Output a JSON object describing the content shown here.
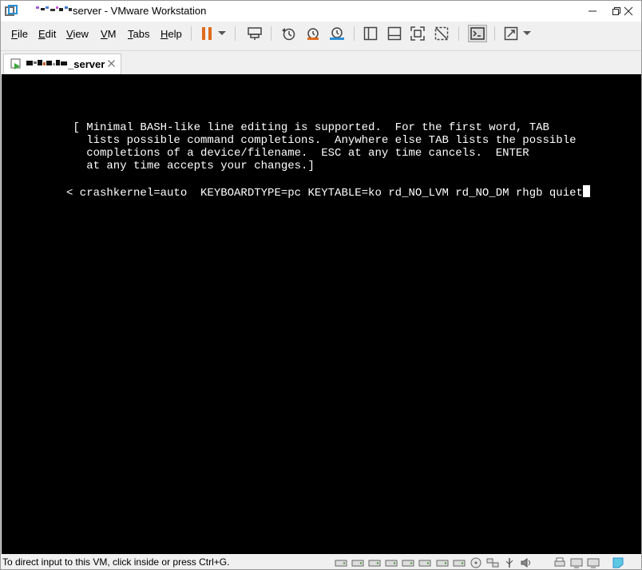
{
  "window": {
    "title": "server - VMware Workstation"
  },
  "menu": {
    "items": [
      {
        "label": "File",
        "key": "F",
        "rest": "ile"
      },
      {
        "label": "Edit",
        "key": "E",
        "rest": "dit"
      },
      {
        "label": "View",
        "key": "V",
        "rest": "iew"
      },
      {
        "label": "VM",
        "key": "V",
        "rest": "M"
      },
      {
        "label": "Tabs",
        "key": "T",
        "rest": "abs"
      },
      {
        "label": "Help",
        "key": "H",
        "rest": "elp"
      }
    ]
  },
  "toolbar": {
    "icons": [
      "pause-icon",
      "dropdown-arrow-icon",
      "send-ctrl-alt-del-icon",
      "snapshot-icon",
      "revert-snapshot-icon",
      "snapshot-manager-icon",
      "show-library-icon",
      "thumbnail-bar-icon",
      "fullscreen-icon",
      "unity-icon",
      "console-view-icon",
      "stretch-guest-icon",
      "dropdown-arrow-icon"
    ],
    "accent_color": "#e06a1b"
  },
  "tab": {
    "label": "_server"
  },
  "console": {
    "lines": [
      " [ Minimal BASH-like line editing is supported.  For the first word, TAB",
      "   lists possible command completions.  Anywhere else TAB lists the possible",
      "   completions of a device/filename.  ESC at any time cancels.  ENTER",
      "   at any time accepts your changes.]"
    ],
    "command": "< crashkernel=auto  KEYBOARDTYPE=pc KEYTABLE=ko rd_NO_LVM rd_NO_DM rhgb quiet"
  },
  "statusbar": {
    "text": "To direct input to this VM, click inside or press Ctrl+G.",
    "icons": [
      "hdd-icon",
      "hdd-icon",
      "hdd-icon",
      "hdd-icon",
      "hdd-icon",
      "hdd-icon",
      "cdrom-icon",
      "network-icon",
      "usb-icon",
      "sound-icon",
      "printer-icon",
      "display-icon",
      "message-icon"
    ]
  }
}
